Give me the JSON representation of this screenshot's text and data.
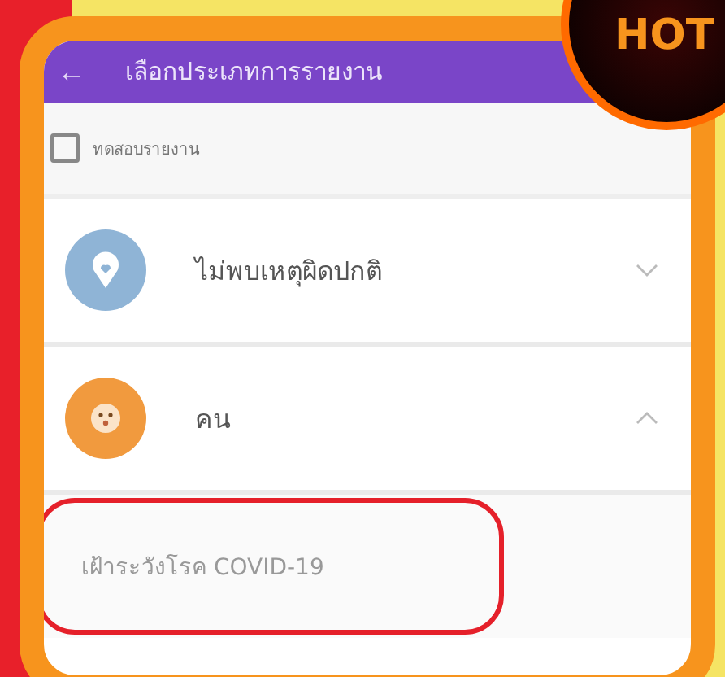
{
  "badge": {
    "text": "HOT"
  },
  "header": {
    "back_icon": "←",
    "title": "เลือกประเภทการรายงาน"
  },
  "test_option": {
    "label": "ทดสอบรายงาน",
    "checked": false
  },
  "categories": [
    {
      "label": "ไม่พบเหตุผิดปกติ",
      "expanded": false,
      "color": "#8fb4d6",
      "kind": "pin"
    },
    {
      "label": "คน",
      "expanded": true,
      "color": "#f19a3e",
      "kind": "face"
    }
  ],
  "subitems": [
    {
      "label": "เฝ้าระวังโรค COVID-19",
      "highlighted": true
    }
  ]
}
